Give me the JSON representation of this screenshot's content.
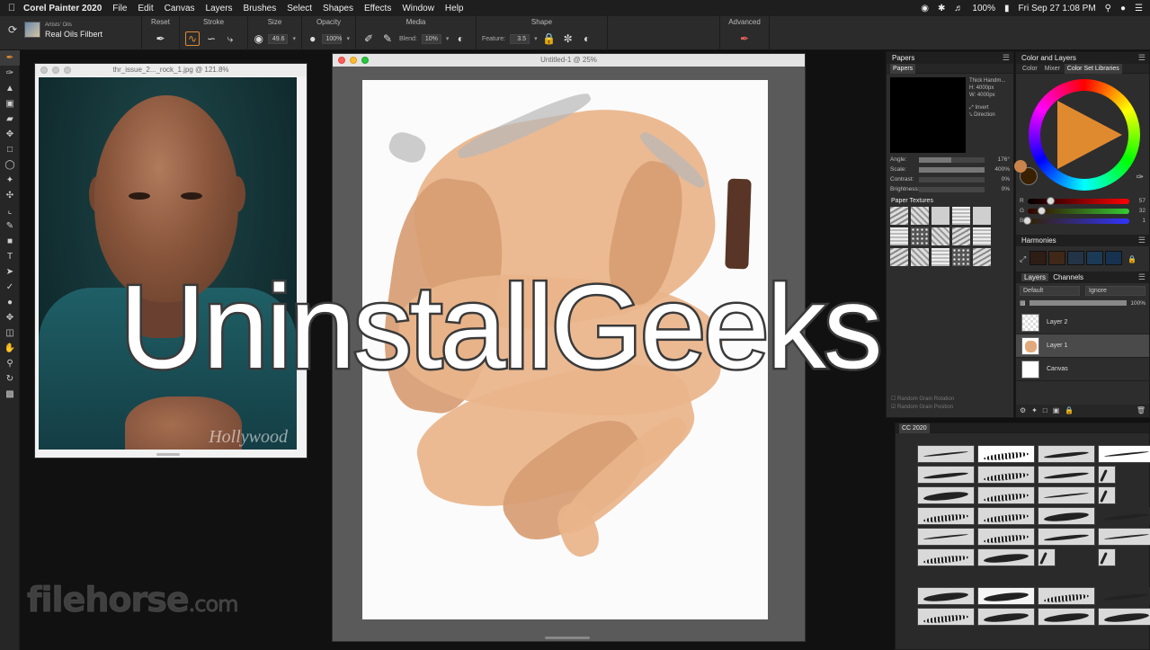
{
  "menubar": {
    "app_name": "Corel Painter 2020",
    "items": [
      "File",
      "Edit",
      "Canvas",
      "Layers",
      "Brushes",
      "Select",
      "Shapes",
      "Effects",
      "Window",
      "Help"
    ],
    "battery": "100%",
    "datetime": "Fri Sep 27  1:08 PM"
  },
  "propbar": {
    "brush_category": "Artists' Oils",
    "brush_variant": "Real Oils Filbert",
    "reset_label": "Reset",
    "stroke_label": "Stroke",
    "size_label": "Size",
    "size_value": "49.6",
    "opacity_label": "Opacity",
    "opacity_value": "100%",
    "media_label": "Media",
    "blend_label": "Blend:",
    "blend_value": "10%",
    "shape_label": "Shape",
    "feature_label": "Feature:",
    "feature_value": "3.5",
    "advanced_label": "Advanced"
  },
  "reference_window": {
    "title": "thr_issue_2..._rock_1.jpg @ 121.8%",
    "magazine_mark": "Hollywood"
  },
  "canvas_window": {
    "title": "Untitled-1 @ 25%"
  },
  "papers_panel": {
    "title": "Papers",
    "tab": "Papers",
    "paper_name": "Thick Handm...",
    "height": "H: 4000px",
    "width": "W: 4000px",
    "invert_label": "Invert",
    "direction_label": "Direction",
    "props": [
      {
        "label": "Angle:",
        "value": "176°",
        "fill": 0.49
      },
      {
        "label": "Scale:",
        "value": "400%",
        "fill": 1.0
      },
      {
        "label": "Contrast:",
        "value": "0%",
        "fill": 0.0
      },
      {
        "label": "Brightness:",
        "value": "0%",
        "fill": 0.0
      }
    ],
    "textures_label": "Paper Textures",
    "random_grain_rotation": "Random Grain Rotation",
    "random_grain_position": "Random Grain Position"
  },
  "color_panel": {
    "title": "Color and Layers",
    "tabs": [
      "Color",
      "Mixer",
      "Color Set Libraries"
    ],
    "rgb": [
      {
        "label": "R",
        "value": "57",
        "fraction": 0.22
      },
      {
        "label": "G",
        "value": "32",
        "fraction": 0.13
      },
      {
        "label": "B",
        "value": "1",
        "fraction": 0.0
      }
    ],
    "harmonies_label": "Harmonies",
    "harmony_colors": [
      "#2e1d14",
      "#402818",
      "#233447",
      "#1b3a55",
      "#16324f"
    ]
  },
  "layers_panel": {
    "tabs": [
      "Layers",
      "Channels"
    ],
    "composite_method": "Default",
    "composite_depth": "Ignore",
    "opacity_value": "100%",
    "layers": [
      {
        "name": "Layer 2",
        "thumb": "checker",
        "selected": false
      },
      {
        "name": "Layer 1",
        "thumb": "paint",
        "selected": true
      },
      {
        "name": "Canvas",
        "thumb": "white",
        "selected": false
      }
    ]
  },
  "brush_library": {
    "title": "CC 2020"
  },
  "overlay": {
    "headline": "UninstallGeeks",
    "watermark": "filehorse",
    "watermark_suffix": ".com"
  }
}
